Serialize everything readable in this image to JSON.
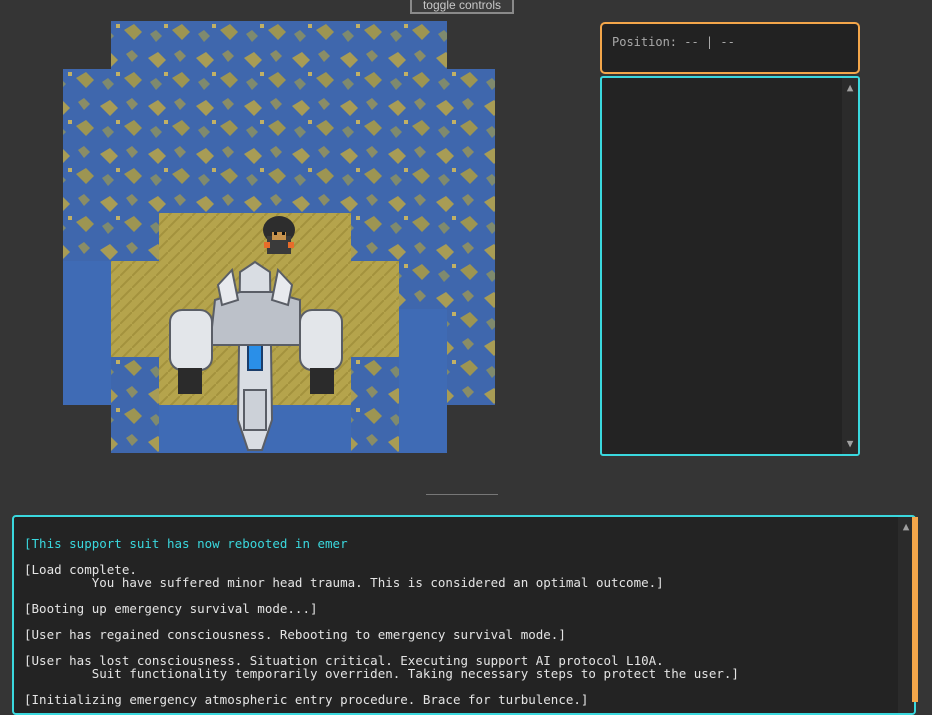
{
  "controls": {
    "toggle_label": "toggle controls"
  },
  "status": {
    "position_text": "Position: -- | --"
  },
  "side_panel": {
    "scroll_up": "▲",
    "scroll_down": "▼"
  },
  "log": {
    "entries": [
      {
        "text": "[This support suit has now rebooted in emer",
        "highlight": true
      },
      {
        "text": "[Load complete.\n         You have suffered minor head trauma. This is considered an optimal outcome.]",
        "highlight": false
      },
      {
        "text": "[Booting up emergency survival mode...]",
        "highlight": false
      },
      {
        "text": "[User has regained consciousness. Rebooting to emergency survival mode.]",
        "highlight": false
      },
      {
        "text": "[User has lost consciousness. Situation critical. Executing support AI protocol L10A.\n         Suit functionality temporarily overriden. Taking necessary steps to protect the user.]",
        "highlight": false
      },
      {
        "text": "[Initializing emergency atmospheric entry procedure. Brace for turbulence.]",
        "highlight": false
      }
    ]
  },
  "colors": {
    "accent_orange": "#f3a64a",
    "accent_cyan": "#3ad8de",
    "water": "#3f6bb5",
    "sand": "#b7a64e",
    "background": "#353535"
  }
}
